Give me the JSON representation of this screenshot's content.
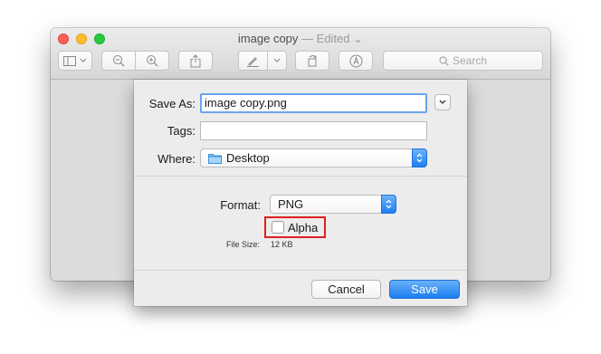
{
  "window": {
    "title": "image copy",
    "title_separator": "—",
    "edited": "Edited",
    "search_placeholder": "Search",
    "toolbar_icons": [
      "sidebar-icon",
      "chevron-down-icon",
      "zoom-out-icon",
      "zoom-in-icon",
      "share-icon",
      "markup-pen-icon",
      "chevron-down-icon",
      "rotate-icon",
      "markup-toolbox-icon",
      "search-icon"
    ]
  },
  "sheet": {
    "save_as_label": "Save As:",
    "save_as_value": "image copy.png",
    "tags_label": "Tags:",
    "tags_value": "",
    "where_label": "Where:",
    "where_value": "Desktop",
    "format_label": "Format:",
    "format_value": "PNG",
    "alpha_label": "Alpha",
    "alpha_checked": false,
    "file_size_label": "File Size:",
    "file_size_value": "12 KB",
    "cancel_label": "Cancel",
    "save_label": "Save"
  },
  "colors": {
    "accent": "#1b7df0",
    "highlight_box": "#e02020",
    "close": "#ff5f57",
    "minimize": "#ffbd2e",
    "zoom": "#28c940"
  }
}
